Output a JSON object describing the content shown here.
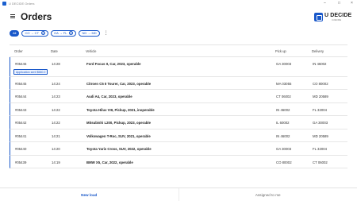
{
  "window": {
    "title": "U DECIDE Orders",
    "controls": [
      "–",
      "□",
      "×"
    ]
  },
  "header": {
    "title": "Orders",
    "logo_text": "U DECIDE",
    "logo_subtext": "U-DECIDE"
  },
  "filters": [
    {
      "label": "All",
      "active": true,
      "removable": false
    },
    {
      "label": "CO → CT",
      "active": false,
      "removable": true
    },
    {
      "label": "GA → FL",
      "active": false,
      "removable": true
    },
    {
      "label": "ND → MD",
      "active": false,
      "removable": false
    }
  ],
  "more_menu": "⋮",
  "table": {
    "columns": {
      "order": "Order",
      "date": "Date",
      "vehicle": "Vehicle",
      "pickup": "Pick up",
      "delivery": "Delivery"
    },
    "rows": [
      {
        "order": "#05446",
        "date": "14:28",
        "vehicle": "Ford Focus II, Car, 2023, operable",
        "pickup": "GA 30003",
        "delivery": "IN 46002",
        "note": "Application sent $560.0"
      },
      {
        "order": "#05445",
        "date": "14:24",
        "vehicle": "Citroen C5 II Tourer, Car, 2023, operable",
        "pickup": "MA 03055",
        "delivery": "CO 80002",
        "note": ""
      },
      {
        "order": "#05444",
        "date": "14:23",
        "vehicle": "Audi A4, Car, 2023, operable",
        "pickup": "CT 06002",
        "delivery": "MD 20589",
        "note": ""
      },
      {
        "order": "#05443",
        "date": "14:22",
        "vehicle": "Toyota Hilux VIII, Pickup, 2021, inoperable",
        "pickup": "IN 46002",
        "delivery": "FL 32004",
        "note": ""
      },
      {
        "order": "#05442",
        "date": "14:22",
        "vehicle": "Mitsubishi L200, Pickup, 2023, operable",
        "pickup": "IL 60002",
        "delivery": "GA 30003",
        "note": ""
      },
      {
        "order": "#05441",
        "date": "14:21",
        "vehicle": "Volkswagen T-Roc, SUV, 2021, operable",
        "pickup": "IN 46002",
        "delivery": "MD 20589",
        "note": ""
      },
      {
        "order": "#05440",
        "date": "14:20",
        "vehicle": "Toyota Yaris Cross, SUV, 2022, operable",
        "pickup": "GA 30003",
        "delivery": "FL 32004",
        "note": ""
      },
      {
        "order": "#05439",
        "date": "14:19",
        "vehicle": "BMW X5, Car, 2022, operable",
        "pickup": "CO 80002",
        "delivery": "CT 06002",
        "note": ""
      }
    ]
  },
  "bottom_tabs": [
    {
      "label": "New load",
      "active": true
    },
    {
      "label": "Assigned to me",
      "active": false
    }
  ],
  "colors": {
    "accent": "#1857c9",
    "accent_light": "#eef4ff",
    "divider": "#e3e3e3"
  }
}
